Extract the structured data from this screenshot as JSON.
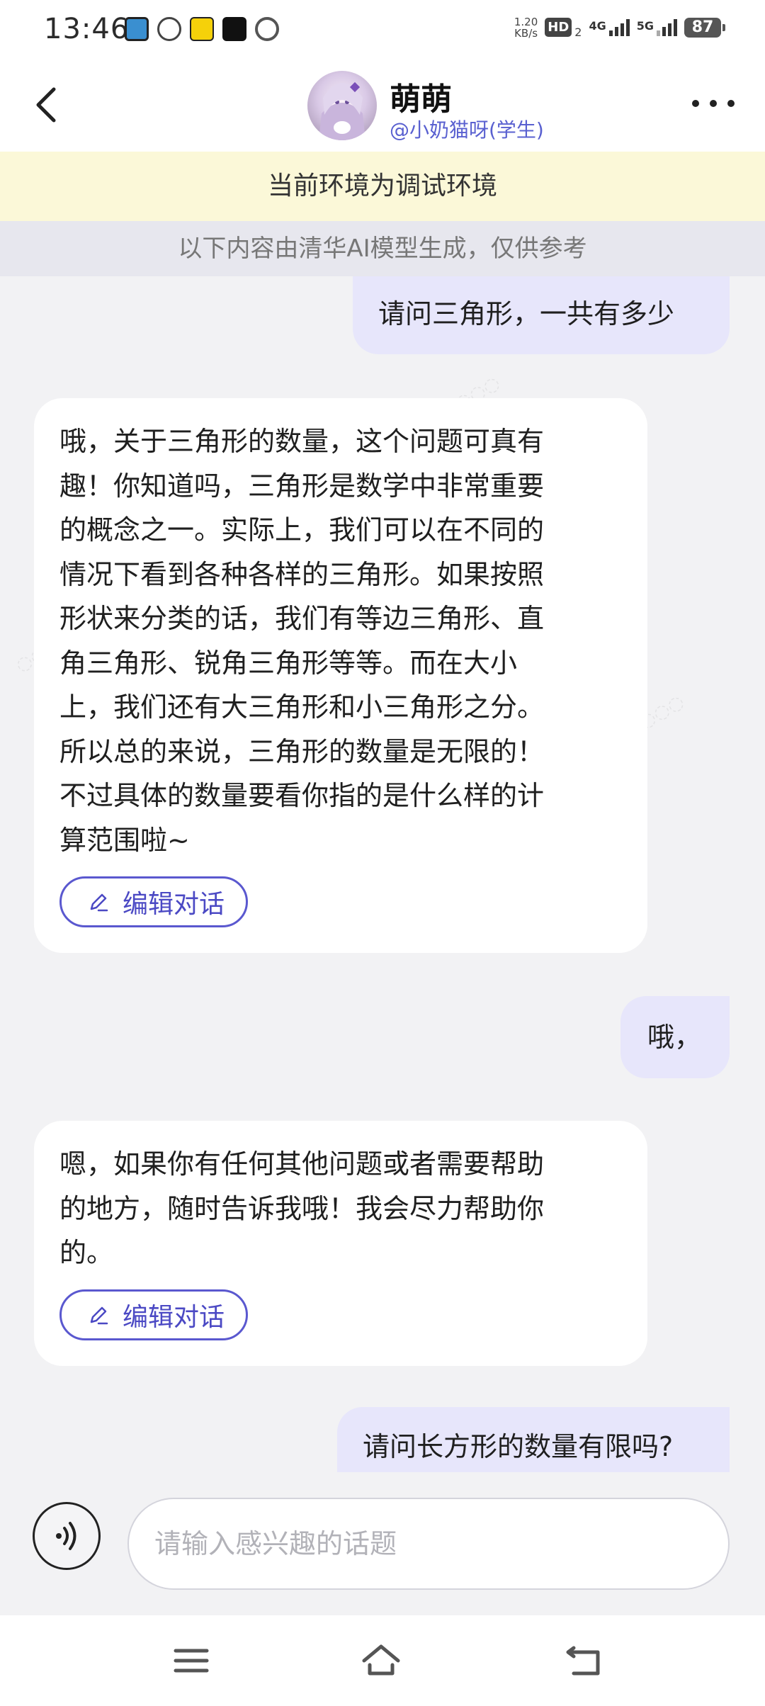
{
  "status_bar": {
    "time": "13:46",
    "net_speed_value": "1.20",
    "net_speed_unit": "KB/s",
    "hd_label": "HD",
    "hd_sub": "2",
    "signal_1": "4G",
    "signal_2": "5G",
    "battery": "87",
    "app_icons": [
      "app-icon-1",
      "wechat-icon",
      "kuaidi-icon",
      "tiktok-icon",
      "browser-icon"
    ]
  },
  "header": {
    "name": "萌萌",
    "handle": "@小奶猫呀(学生)"
  },
  "banners": {
    "debug": "当前环境为调试环境",
    "disclaimer": "以下内容由清华AI模型生成，仅供参考"
  },
  "messages": [
    {
      "role": "user",
      "text": "请问三角形，一共有多少"
    },
    {
      "role": "ai",
      "lines": [
        "哦，关于三角形的数量，这个问题可真有",
        "趣！你知道吗，三角形是数学中非常重要",
        "的概念之一。实际上，我们可以在不同的",
        "情况下看到各种各样的三角形。如果按照",
        "形状来分类的话，我们有等边三角形、直",
        "角三角形、锐角三角形等等。而在大小",
        "上，我们还有大三角形和小三角形之分。",
        "所以总的来说，三角形的数量是无限的！",
        "不过具体的数量要看你指的是什么样的计",
        "算范围啦~"
      ],
      "edit_label": "编辑对话"
    },
    {
      "role": "user",
      "text": "哦，"
    },
    {
      "role": "ai",
      "lines": [
        "嗯，如果你有任何其他问题或者需要帮助",
        "的地方，随时告诉我哦！我会尽力帮助你",
        "的。"
      ],
      "edit_label": "编辑对话"
    },
    {
      "role": "user",
      "text": "请问长方形的数量有限吗?"
    }
  ],
  "input": {
    "placeholder": "请输入感兴趣的话题"
  },
  "nav": [
    "menu-icon",
    "home-icon",
    "back-icon"
  ]
}
